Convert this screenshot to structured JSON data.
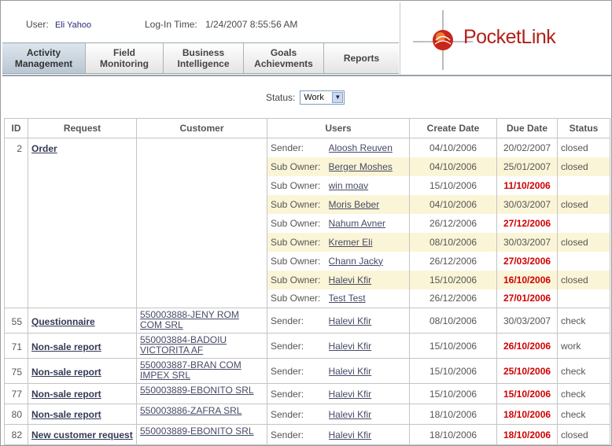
{
  "header": {
    "user_label": "User:",
    "user_name": "Eli Yahoo",
    "login_label": "Log-In Time:",
    "login_time": "1/24/2007 8:55:56 AM",
    "logo_text": "PocketLink"
  },
  "nav": [
    {
      "label": "Activity Management",
      "active": true
    },
    {
      "label": "Field Monitoring",
      "active": false
    },
    {
      "label": "Business Intelligence",
      "active": false
    },
    {
      "label": "Goals Achievments",
      "active": false
    },
    {
      "label": "Reports",
      "active": false
    }
  ],
  "filter": {
    "label": "Status:",
    "value": "Work"
  },
  "table": {
    "columns": [
      "ID",
      "Request",
      "Customer",
      "Users",
      "Create Date",
      "Due Date",
      "Status"
    ],
    "groups": [
      {
        "id": "2",
        "request": "Order",
        "customer": "",
        "rows": [
          {
            "role": "Sender:",
            "user": "Aloosh Reuven",
            "create": "04/10/2006",
            "due": "20/02/2007",
            "overdue": false,
            "status": "closed"
          },
          {
            "role": "Sub Owner:",
            "user": "Berger Moshes",
            "create": "04/10/2006",
            "due": "25/01/2007",
            "overdue": false,
            "status": "closed"
          },
          {
            "role": "Sub Owner:",
            "user": "win moav",
            "create": "15/10/2006",
            "due": "11/10/2006",
            "overdue": true,
            "status": ""
          },
          {
            "role": "Sub Owner:",
            "user": "Moris Beber",
            "create": "04/10/2006",
            "due": "30/03/2007",
            "overdue": false,
            "status": "closed"
          },
          {
            "role": "Sub Owner:",
            "user": "Nahum Avner",
            "create": "26/12/2006",
            "due": "27/12/2006",
            "overdue": true,
            "status": ""
          },
          {
            "role": "Sub Owner:",
            "user": "Kremer Eli",
            "create": "08/10/2006",
            "due": "30/03/2007",
            "overdue": false,
            "status": "closed"
          },
          {
            "role": "Sub Owner:",
            "user": "Chann Jacky",
            "create": "26/12/2006",
            "due": "27/03/2006",
            "overdue": true,
            "status": ""
          },
          {
            "role": "Sub Owner:",
            "user": "Halevi Kfir",
            "create": "15/10/2006",
            "due": "16/10/2006",
            "overdue": true,
            "status": "closed"
          },
          {
            "role": "Sub Owner:",
            "user": "Test Test",
            "create": "26/12/2006",
            "due": "27/01/2006",
            "overdue": true,
            "status": ""
          }
        ]
      },
      {
        "id": "55",
        "request": "Questionnaire",
        "customer": "550003888-JENY ROM COM SRL",
        "rows": [
          {
            "role": "Sender:",
            "user": "Halevi Kfir",
            "create": "08/10/2006",
            "due": "30/03/2007",
            "overdue": false,
            "status": "check"
          }
        ]
      },
      {
        "id": "71",
        "request": "Non-sale report",
        "customer": "550003884-BADOIU VICTORITA AF",
        "rows": [
          {
            "role": "Sender:",
            "user": "Halevi Kfir",
            "create": "15/10/2006",
            "due": "26/10/2006",
            "overdue": true,
            "status": "work"
          }
        ]
      },
      {
        "id": "75",
        "request": "Non-sale report",
        "customer": "550003887-BRAN COM IMPEX SRL",
        "rows": [
          {
            "role": "Sender:",
            "user": "Halevi Kfir",
            "create": "15/10/2006",
            "due": "25/10/2006",
            "overdue": true,
            "status": "check"
          }
        ]
      },
      {
        "id": "77",
        "request": "Non-sale report",
        "customer": "550003889-EBONITO SRL",
        "rows": [
          {
            "role": "Sender:",
            "user": "Halevi Kfir",
            "create": "15/10/2006",
            "due": "15/10/2006",
            "overdue": true,
            "status": "check"
          }
        ]
      },
      {
        "id": "80",
        "request": "Non-sale report",
        "customer": "550003886-ZAFRA SRL",
        "rows": [
          {
            "role": "Sender:",
            "user": "Halevi Kfir",
            "create": "18/10/2006",
            "due": "18/10/2006",
            "overdue": true,
            "status": "check"
          }
        ]
      },
      {
        "id": "82",
        "request": "New customer request",
        "customer": "550003889-EBONITO SRL",
        "rows": [
          {
            "role": "Sender:",
            "user": "Halevi Kfir",
            "create": "18/10/2006",
            "due": "18/10/2006",
            "overdue": true,
            "status": "closed"
          }
        ]
      }
    ]
  },
  "colors": {
    "overdue": "#d00000",
    "row_highlight": "#fbf5d7",
    "brand_red": "#b0221a"
  }
}
